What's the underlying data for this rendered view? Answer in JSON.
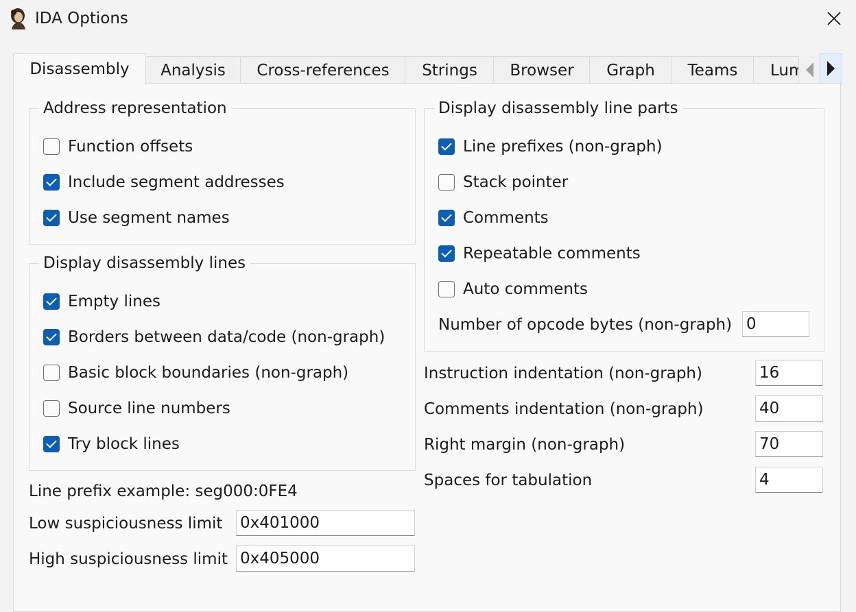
{
  "window": {
    "title": "IDA Options",
    "icon": "ida-app-icon",
    "close_icon": "close-icon"
  },
  "tabs": [
    {
      "label": "Disassembly",
      "active": true
    },
    {
      "label": "Analysis"
    },
    {
      "label": "Cross-references"
    },
    {
      "label": "Strings"
    },
    {
      "label": "Browser"
    },
    {
      "label": "Graph"
    },
    {
      "label": "Teams"
    },
    {
      "label": "Lum"
    }
  ],
  "tab_scroll": {
    "left_icon": "scroll-left-icon",
    "right_icon": "scroll-right-icon"
  },
  "address_representation": {
    "title": "Address representation",
    "options": [
      {
        "label": "Function offsets",
        "checked": false
      },
      {
        "label": "Include segment addresses",
        "checked": true
      },
      {
        "label": "Use segment names",
        "checked": true
      }
    ]
  },
  "display_lines": {
    "title": "Display disassembly lines",
    "options": [
      {
        "label": "Empty lines",
        "checked": true
      },
      {
        "label": "Borders between data/code (non-graph)",
        "checked": true
      },
      {
        "label": "Basic block boundaries (non-graph)",
        "checked": false
      },
      {
        "label": "Source line numbers",
        "checked": false
      },
      {
        "label": "Try block lines",
        "checked": true
      }
    ]
  },
  "line_parts": {
    "title": "Display disassembly line parts",
    "options": [
      {
        "label": "Line prefixes (non-graph)",
        "checked": true
      },
      {
        "label": "Stack pointer",
        "checked": false
      },
      {
        "label": "Comments",
        "checked": true
      },
      {
        "label": "Repeatable comments",
        "checked": true
      },
      {
        "label": "Auto comments",
        "checked": false
      }
    ],
    "opcode_bytes_label": "Number of opcode bytes (non-graph)",
    "opcode_bytes_value": "0"
  },
  "line_prefix_example": "Line prefix example: seg000:0FE4",
  "low_limit": {
    "label": "Low suspiciousness limit",
    "value": "0x401000"
  },
  "high_limit": {
    "label": "High suspiciousness limit",
    "value": "0x405000"
  },
  "indentation": {
    "instruction": {
      "label": "Instruction indentation (non-graph)",
      "value": "16"
    },
    "comments": {
      "label": "Comments indentation (non-graph)",
      "value": "40"
    },
    "right_margin": {
      "label": "Right margin (non-graph)",
      "value": "70"
    },
    "tabulation": {
      "label": "Spaces for tabulation",
      "value": "4"
    }
  },
  "colors": {
    "checkbox_checked": "#0a5fb4",
    "accent_tab_scroll": "#e3eefb"
  }
}
